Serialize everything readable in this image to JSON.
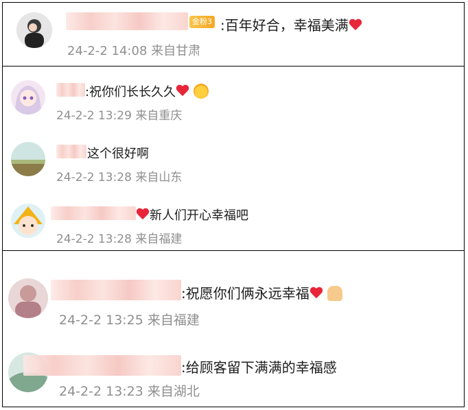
{
  "comments": [
    {
      "text": ":百年好合，幸福美满",
      "meta": "24-2-2 14:08 来自甘肃",
      "badge": "金粉3"
    },
    {
      "text": ":祝你们长长久久",
      "meta": "24-2-2 13:29 来自重庆"
    },
    {
      "text": "这个很好啊",
      "meta": "24-2-2 13:28 来自山东"
    },
    {
      "text": "新人们开心幸福吧",
      "meta": "24-2-2 13:28 来自福建"
    },
    {
      "text": ":祝愿你们俩永远幸福",
      "meta": "24-2-2 13:25 来自福建"
    },
    {
      "text": ":给顾客留下满满的幸福感",
      "meta": "24-2-2 13:23 来自湖北"
    }
  ]
}
